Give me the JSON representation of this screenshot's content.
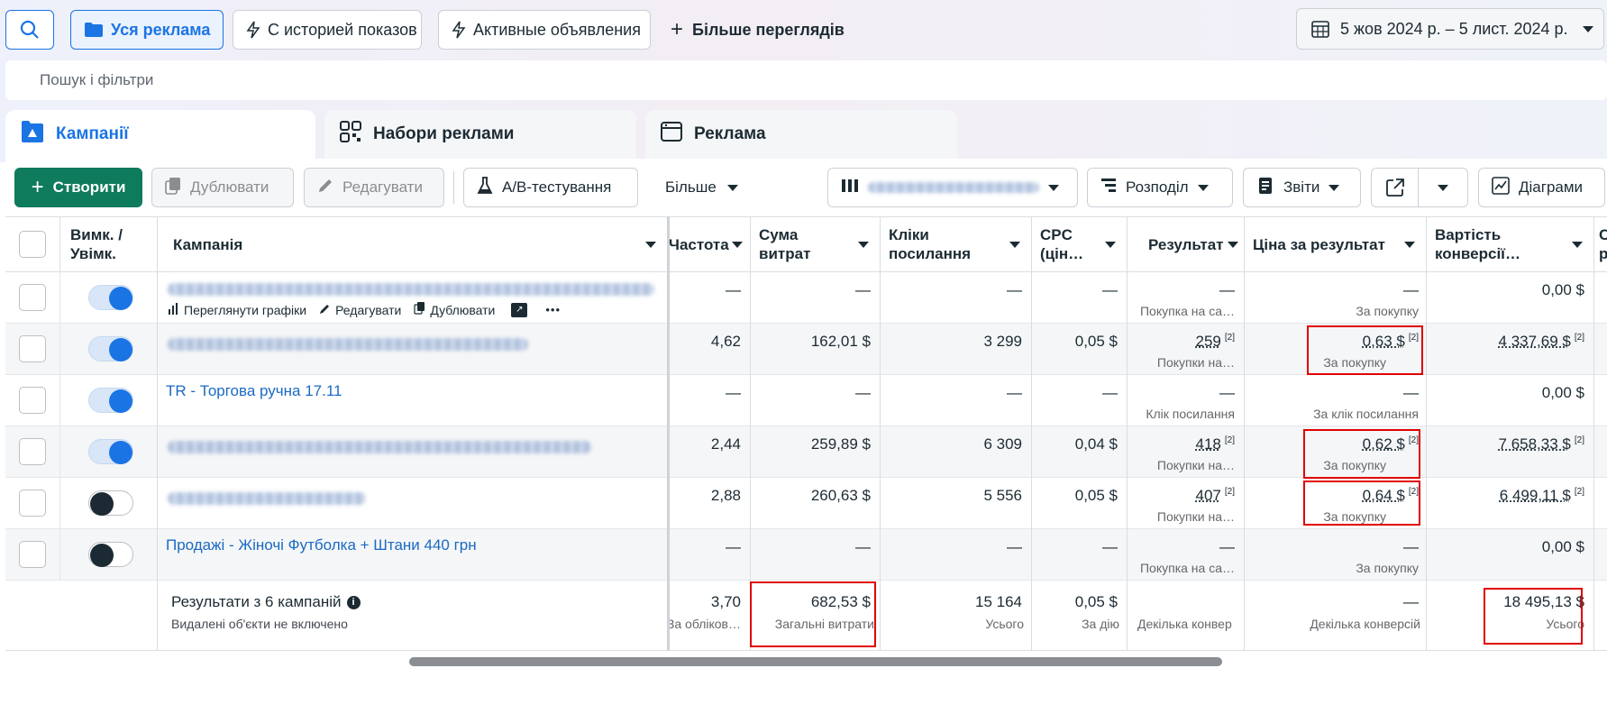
{
  "topbar": {
    "views": [
      "Уся реклама",
      "С историей показов",
      "Активные объявления"
    ],
    "more_views": "Більше переглядів",
    "date_range": "5 жов 2024 р. – 5 лист. 2024 р."
  },
  "search": {
    "placeholder": "Пошук і фільтри"
  },
  "level_tabs": [
    "Кампанії",
    "Набори реклами",
    "Реклама"
  ],
  "toolbar": {
    "create": "Створити",
    "duplicate": "Дублювати",
    "edit": "Редагувати",
    "ab_test": "A/B-тестування",
    "more": "Більше",
    "breakdown": "Розподіл",
    "reports": "Звіти",
    "charts": "Діаграми"
  },
  "columns": {
    "onoff": "Вимк. / Увімк.",
    "campaign": "Кампанія",
    "frequency": "Частота",
    "spend": "Сума витрат",
    "clicks": "Кліки посилання",
    "cpc": "CPC (цін…",
    "results": "Результат",
    "cost_per_result": "Ціна за результат",
    "conv_value": "Вартість конверсії…",
    "extra": "С р"
  },
  "row_actions": [
    "Переглянути графіки",
    "Редагувати",
    "Дублювати",
    "•••"
  ],
  "rows": [
    {
      "name": "",
      "on": true,
      "frequency": "—",
      "spend": "—",
      "clicks": "—",
      "cpc": "—",
      "results": "—",
      "results_sub": "Покупка на са…",
      "cpr": "—",
      "cpr_sub": "За покупку",
      "conv": "0,00 $"
    },
    {
      "name": "",
      "on": true,
      "frequency": "4,62",
      "spend": "162,01 $",
      "clicks": "3 299",
      "cpc": "0,05 $",
      "results": "259",
      "results_sub": "Покупки на…",
      "cpr": "0,63 $",
      "cpr_sub": "За покупку",
      "conv": "4 337,69 $"
    },
    {
      "name": "TR - Торгова ручна 17.11",
      "on": true,
      "frequency": "—",
      "spend": "—",
      "clicks": "—",
      "cpc": "—",
      "results": "—",
      "results_sub": "Клік посилання",
      "cpr": "—",
      "cpr_sub": "За клік посилання",
      "conv": "0,00 $"
    },
    {
      "name": "",
      "on": true,
      "frequency": "2,44",
      "spend": "259,89 $",
      "clicks": "6 309",
      "cpc": "0,04 $",
      "results": "418",
      "results_sub": "Покупки на…",
      "cpr": "0,62 $",
      "cpr_sub": "За покупку",
      "conv": "7 658,33 $"
    },
    {
      "name": "",
      "on": false,
      "frequency": "2,88",
      "spend": "260,63 $",
      "clicks": "5 556",
      "cpc": "0,05 $",
      "results": "407",
      "results_sub": "Покупки на…",
      "cpr": "0,64 $",
      "cpr_sub": "За покупку",
      "conv": "6 499,11 $"
    },
    {
      "name": "Продажі - Жіночі Футболка + Штани 440 грн",
      "on": false,
      "frequency": "—",
      "spend": "—",
      "clicks": "—",
      "cpc": "—",
      "results": "—",
      "results_sub": "Покупка на са…",
      "cpr": "—",
      "cpr_sub": "За покупку",
      "conv": "0,00 $"
    }
  ],
  "footnote_mark": "[2]",
  "summary": {
    "title": "Результати з 6 кампаній",
    "note": "Видалені об'єкти не включено",
    "frequency": "3,70",
    "frequency_sub": "За обліков…",
    "spend": "682,53 $",
    "spend_sub": "Загальні витрати",
    "clicks": "15 164",
    "clicks_sub": "Усього",
    "cpc": "0,05 $",
    "cpc_sub": "За дію",
    "results": "",
    "results_sub": "Декілька конвер",
    "cpr": "—",
    "cpr_sub": "Декілька конверсій",
    "conv": "18 495,13 $",
    "conv_sub": "Усього"
  }
}
